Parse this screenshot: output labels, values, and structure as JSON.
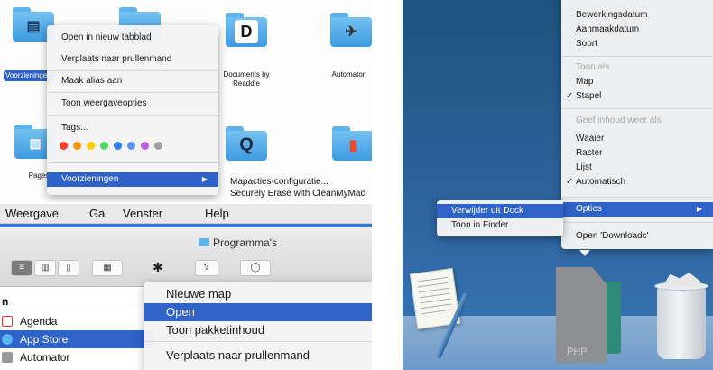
{
  "tl": {
    "folders": {
      "voorzieningen": "Voorzieningen",
      "documents_by_readdle": "Documents by Readdle",
      "automator": "Automator",
      "pages": "Pages",
      "documents_glyph": "D"
    },
    "context_menu": {
      "items": [
        "Open in nieuw tabblad",
        "Verplaats naar prullenmand",
        "Maak alias aan",
        "Toon weergaveopties",
        "Tags...",
        "Voorzieningen"
      ],
      "submenu_arrow": "▶"
    },
    "tag_colors": [
      "#fb3b30",
      "#ff9500",
      "#ffcc00",
      "#4cd964",
      "#2f7bf6",
      "#b562d8",
      "#a0a0a0"
    ],
    "right_list": [
      "Mapacties-configuratie...",
      "Securely Erase with CleanMyMac"
    ]
  },
  "bl": {
    "menubar": [
      "Weergave",
      "Ga",
      "Venster",
      "Help"
    ],
    "window_title": "Programma's",
    "column_header": "n",
    "files": [
      "Agenda",
      "App Store",
      "Automator"
    ],
    "context_menu": [
      "Nieuwe map",
      "Open",
      "Toon pakketinhoud",
      "Verplaats naar prullenmand"
    ],
    "toolbar_glyphs": {
      "gear": "✱",
      "chevron": "⌄",
      "share": "⇧"
    }
  },
  "right": {
    "menu_items": [
      {
        "label": "Bewerkingsdatum",
        "checked": false,
        "disabled": false
      },
      {
        "label": "Aanmaakdatum",
        "checked": false,
        "disabled": false
      },
      {
        "label": "Soort",
        "checked": false,
        "disabled": false
      },
      {
        "label": "Toon als",
        "checked": false,
        "disabled": true
      },
      {
        "label": "Map",
        "checked": false,
        "disabled": false
      },
      {
        "label": "Stapel",
        "checked": true,
        "disabled": false
      },
      {
        "label": "Geef inhoud weer als",
        "checked": false,
        "disabled": true
      },
      {
        "label": "Waaier",
        "checked": false,
        "disabled": false
      },
      {
        "label": "Raster",
        "checked": false,
        "disabled": false
      },
      {
        "label": "Lijst",
        "checked": false,
        "disabled": false
      },
      {
        "label": "Automatisch",
        "checked": true,
        "disabled": false
      }
    ],
    "opties": "Opties",
    "open_downloads": "Open 'Downloads'",
    "dock_menu": [
      "Verwijder uit Dock",
      "Toon in Finder"
    ],
    "checkmark": "✓",
    "php_label": "PHP",
    "arrow": "▶"
  }
}
